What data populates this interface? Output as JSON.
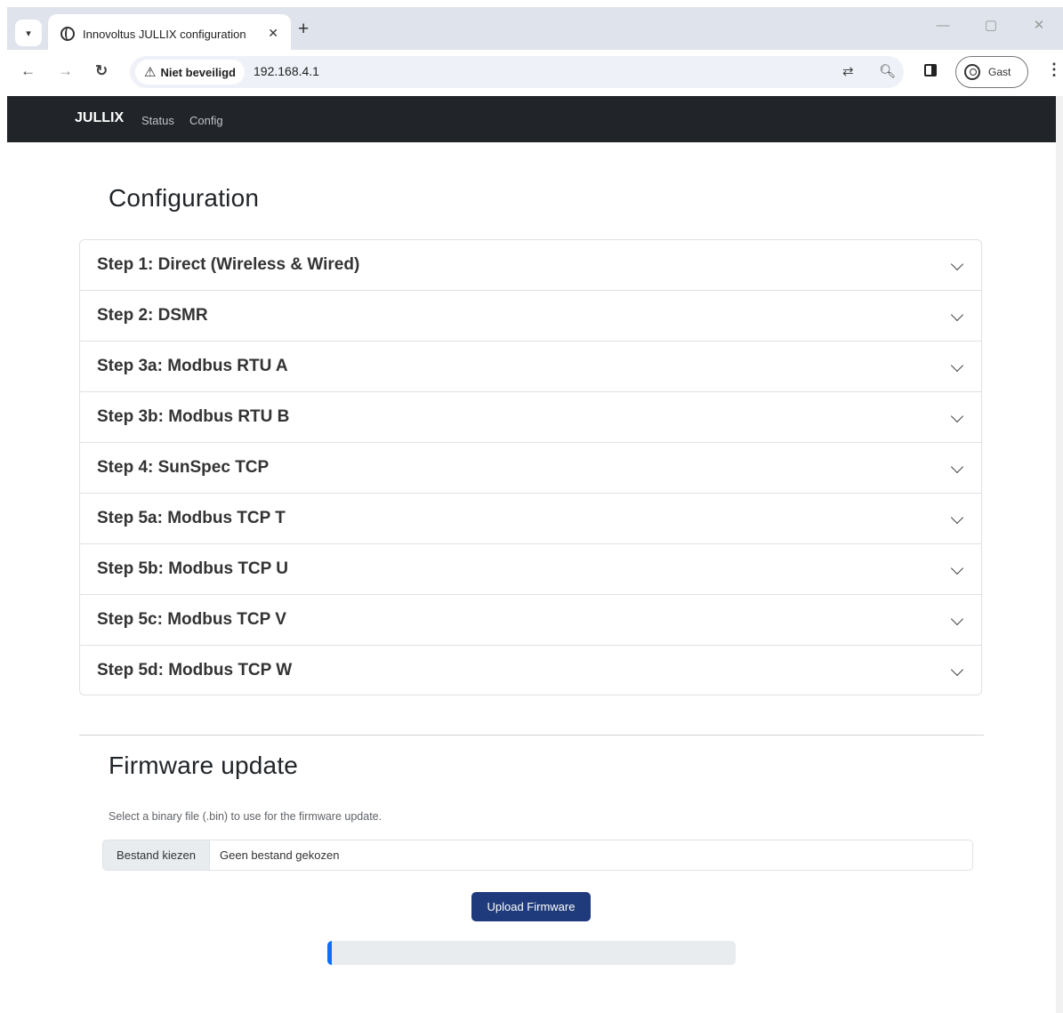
{
  "browser": {
    "tab_title": "Innovoltus JULLIX configuration",
    "security_label": "Niet beveiligd",
    "url": "192.168.4.1",
    "profile_label": "Gast"
  },
  "navbar": {
    "brand": "JULLIX",
    "links": [
      "Status",
      "Config"
    ]
  },
  "configuration": {
    "title": "Configuration",
    "steps": [
      "Step 1: Direct (Wireless & Wired)",
      "Step 2: DSMR",
      "Step 3a: Modbus RTU A",
      "Step 3b: Modbus RTU B",
      "Step 4: SunSpec TCP",
      "Step 5a: Modbus TCP T",
      "Step 5b: Modbus TCP U",
      "Step 5c: Modbus TCP V",
      "Step 5d: Modbus TCP W"
    ]
  },
  "firmware": {
    "title": "Firmware update",
    "hint": "Select a binary file (.bin) to use for the firmware update.",
    "choose_file_label": "Bestand kiezen",
    "file_name": "Geen bestand gekozen",
    "upload_label": "Upload Firmware",
    "progress_percent": 1
  }
}
